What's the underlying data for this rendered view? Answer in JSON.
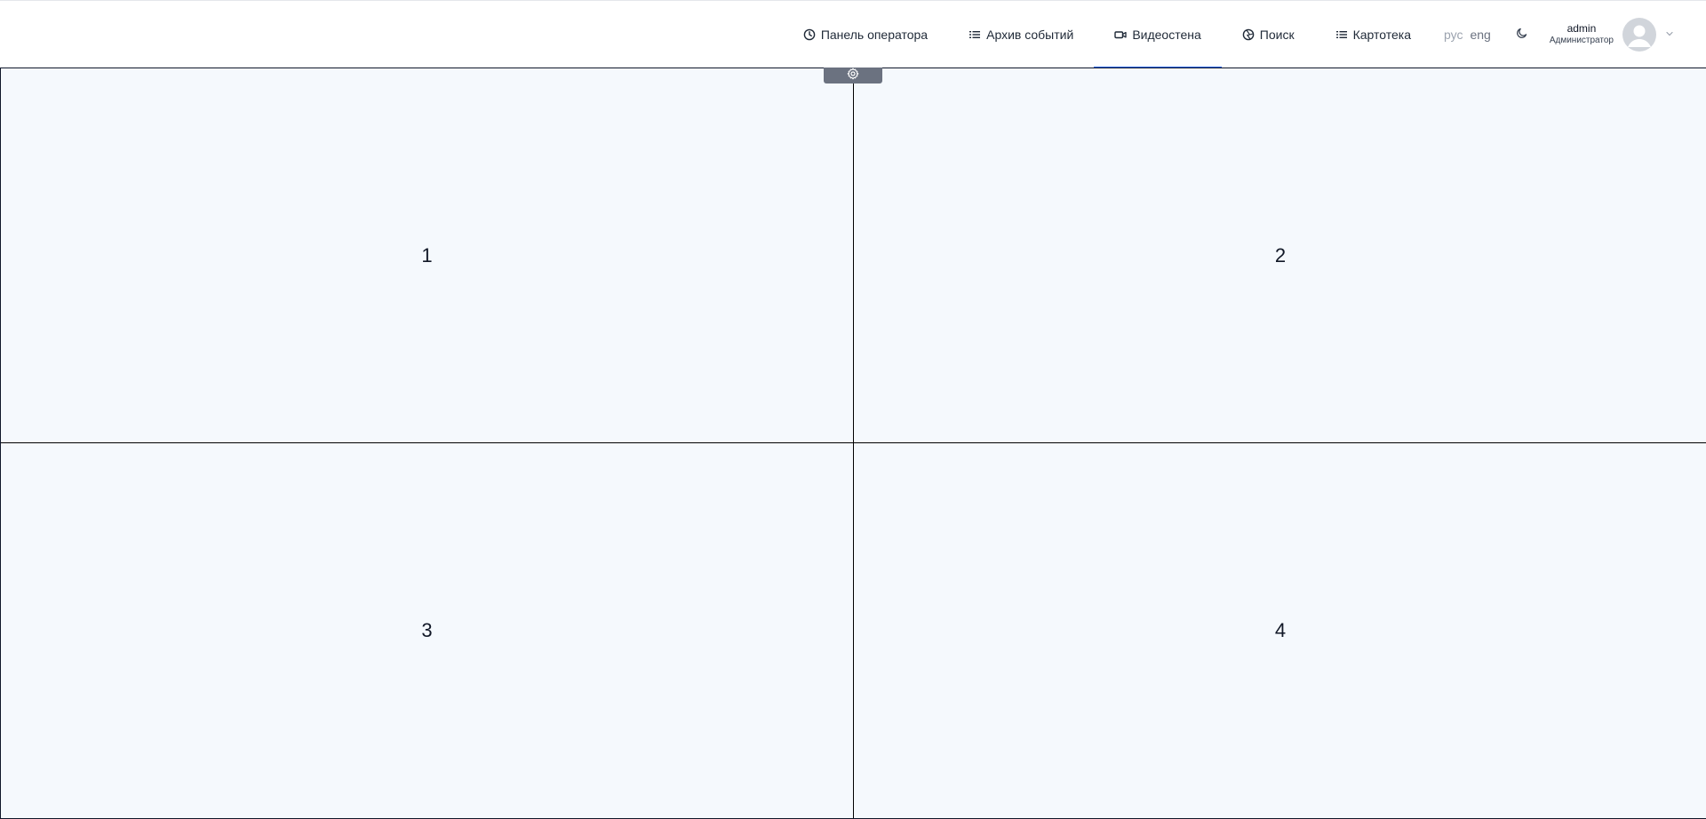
{
  "nav": {
    "items": [
      {
        "label": "Панель оператора",
        "icon": "clock-icon"
      },
      {
        "label": "Архив событий",
        "icon": "list-icon"
      },
      {
        "label": "Видеостена",
        "icon": "video-camera-icon",
        "active": true
      },
      {
        "label": "Поиск",
        "icon": "aperture-icon"
      },
      {
        "label": "Картотека",
        "icon": "list-icon"
      }
    ]
  },
  "lang": {
    "ru": "рус",
    "en": "eng"
  },
  "user": {
    "name": "admin",
    "role": "Администратор"
  },
  "videowall": {
    "settings_icon": "gear-icon",
    "cells": [
      "1",
      "2",
      "3",
      "4"
    ]
  },
  "colors": {
    "accent": "#2563eb",
    "cell_bg": "#f5f9fd",
    "settings_tab": "#6b7280"
  }
}
